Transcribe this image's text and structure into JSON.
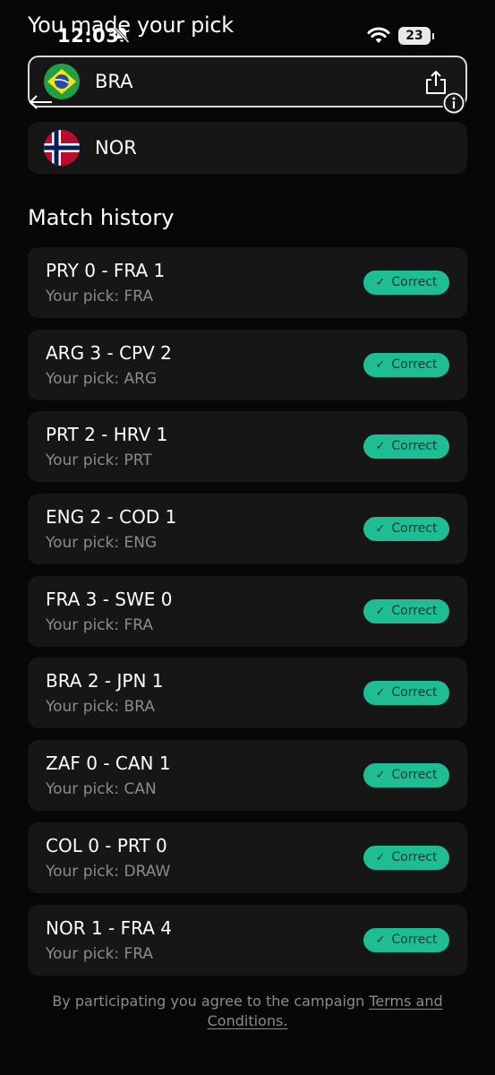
{
  "status_bar": {
    "time": "12:03",
    "battery": "23"
  },
  "header": {
    "title": "You made your pick"
  },
  "teams": [
    {
      "code": "BRA",
      "flag_icon": "brazil-flag-icon",
      "selected": true
    },
    {
      "code": "NOR",
      "flag_icon": "norway-flag-icon",
      "selected": false
    }
  ],
  "history": {
    "title": "Match history",
    "matches": [
      {
        "score": "PRY 0 - FRA 1",
        "pick": "Your pick: FRA",
        "result": "Correct"
      },
      {
        "score": "ARG 3 - CPV 2",
        "pick": "Your pick: ARG",
        "result": "Correct"
      },
      {
        "score": "PRT 2 - HRV 1",
        "pick": "Your pick: PRT",
        "result": "Correct"
      },
      {
        "score": "ENG 2 - COD 1",
        "pick": "Your pick: ENG",
        "result": "Correct"
      },
      {
        "score": "FRA 3 - SWE 0",
        "pick": "Your pick: FRA",
        "result": "Correct"
      },
      {
        "score": "BRA 2 - JPN 1",
        "pick": "Your pick: BRA",
        "result": "Correct"
      },
      {
        "score": "ZAF 0 - CAN 1",
        "pick": "Your pick: CAN",
        "result": "Correct"
      },
      {
        "score": "COL 0 - PRT 0",
        "pick": "Your pick: DRAW",
        "result": "Correct"
      },
      {
        "score": "NOR 1 - FRA 4",
        "pick": "Your pick: FRA",
        "result": "Correct"
      }
    ]
  },
  "footer": {
    "text": "By participating you agree to the campaign ",
    "link_part1": "Terms and",
    "link_part2": "Conditions."
  },
  "colors": {
    "background": "#070707",
    "card": "#161617",
    "badge": "#1fbd93",
    "muted_text": "#8b8b8e"
  }
}
